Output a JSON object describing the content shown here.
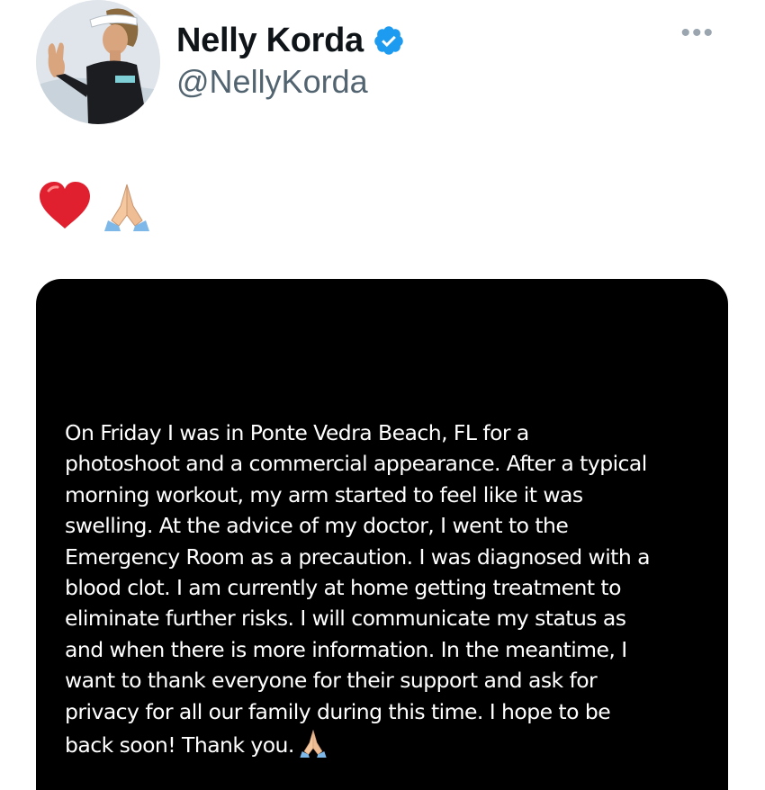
{
  "author": {
    "display_name": "Nelly Korda",
    "handle": "@NellyKorda",
    "verified": true,
    "avatar_icon": "profile-photo"
  },
  "more_button": "•••",
  "tweet_text_icons": [
    "red-heart-icon",
    "folded-hands-icon"
  ],
  "media": {
    "statement": "On Friday I was in Ponte Vedra Beach, FL for a\nphotoshoot and a commercial appearance. After a typical\nmorning workout, my arm started to feel like it was\nswelling. At the advice of my doctor, I went to the\nEmergency Room as a precaution. I was diagnosed with a\nblood clot. I am currently at home getting treatment to\neliminate further risks. I will communicate my status as\nand when there is more information. In the meantime, I\nwant to thank everyone for their support and ask for\nprivacy for all our family during this time. I hope to be\nback soon!  Thank you.",
    "trailing_icon": "folded-hands-icon",
    "background": "#000000"
  },
  "colors": {
    "verified_badge": "#1d9bf0",
    "handle": "#536471",
    "heart": "#e0202e"
  }
}
